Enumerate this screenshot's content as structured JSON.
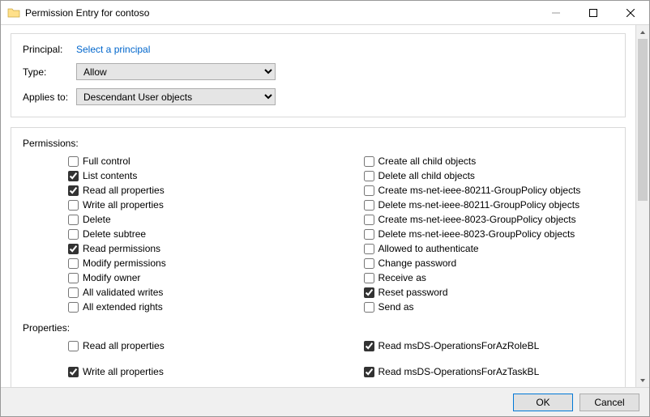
{
  "window": {
    "title": "Permission Entry for contoso"
  },
  "header": {
    "principal_label": "Principal:",
    "principal_link": "Select a principal",
    "type_label": "Type:",
    "type_value": "Allow",
    "applies_label": "Applies to:",
    "applies_value": "Descendant User objects"
  },
  "permissions": {
    "section_label": "Permissions:",
    "left": [
      {
        "label": "Full control",
        "checked": false
      },
      {
        "label": "List contents",
        "checked": true
      },
      {
        "label": "Read all properties",
        "checked": true
      },
      {
        "label": "Write all properties",
        "checked": false
      },
      {
        "label": "Delete",
        "checked": false
      },
      {
        "label": "Delete subtree",
        "checked": false
      },
      {
        "label": "Read permissions",
        "checked": true
      },
      {
        "label": "Modify permissions",
        "checked": false
      },
      {
        "label": "Modify owner",
        "checked": false
      },
      {
        "label": "All validated writes",
        "checked": false
      },
      {
        "label": "All extended rights",
        "checked": false
      }
    ],
    "right": [
      {
        "label": "Create all child objects",
        "checked": false
      },
      {
        "label": "Delete all child objects",
        "checked": false
      },
      {
        "label": "Create ms-net-ieee-80211-GroupPolicy objects",
        "checked": false
      },
      {
        "label": "Delete ms-net-ieee-80211-GroupPolicy objects",
        "checked": false
      },
      {
        "label": "Create ms-net-ieee-8023-GroupPolicy objects",
        "checked": false
      },
      {
        "label": "Delete ms-net-ieee-8023-GroupPolicy objects",
        "checked": false
      },
      {
        "label": "Allowed to authenticate",
        "checked": false
      },
      {
        "label": "Change password",
        "checked": false
      },
      {
        "label": "Receive as",
        "checked": false
      },
      {
        "label": "Reset password",
        "checked": true
      },
      {
        "label": "Send as",
        "checked": false
      }
    ]
  },
  "properties": {
    "section_label": "Properties:",
    "left": [
      {
        "label": "Read all properties",
        "checked": false
      },
      {
        "label": "Write all properties",
        "checked": true
      }
    ],
    "right": [
      {
        "label": "Read msDS-OperationsForAzRoleBL",
        "checked": true
      },
      {
        "label": "Read msDS-OperationsForAzTaskBL",
        "checked": true
      }
    ]
  },
  "footer": {
    "ok": "OK",
    "cancel": "Cancel"
  }
}
